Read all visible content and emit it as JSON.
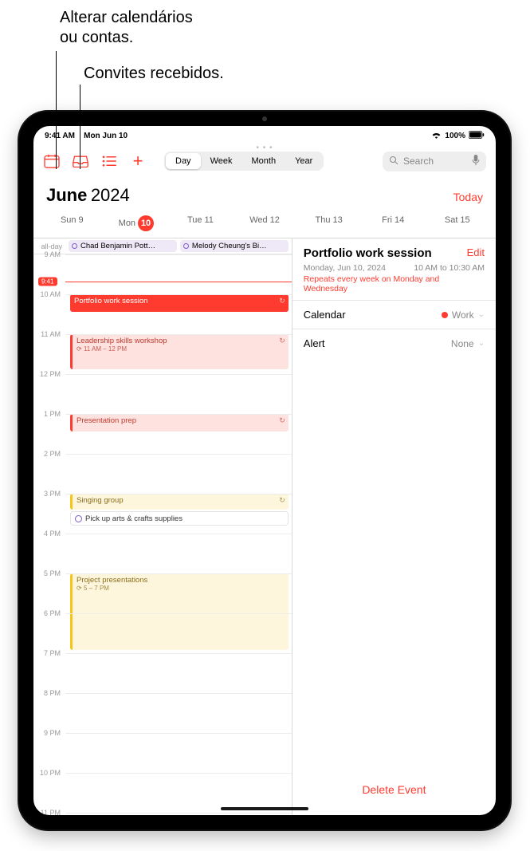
{
  "callouts": {
    "calendars": "Alterar calendários\nou contas.",
    "inbox": "Convites recebidos."
  },
  "status": {
    "time": "9:41 AM",
    "date": "Mon Jun 10",
    "battery": "100%"
  },
  "segments": {
    "day": "Day",
    "week": "Week",
    "month": "Month",
    "year": "Year"
  },
  "search": {
    "placeholder": "Search"
  },
  "header": {
    "month": "June",
    "year": "2024",
    "today": "Today"
  },
  "weekdays": [
    {
      "label": "Sun",
      "num": "9"
    },
    {
      "label": "Mon",
      "num": "10",
      "selected": true
    },
    {
      "label": "Tue",
      "num": "11"
    },
    {
      "label": "Wed",
      "num": "12"
    },
    {
      "label": "Thu",
      "num": "13"
    },
    {
      "label": "Fri",
      "num": "14"
    },
    {
      "label": "Sat",
      "num": "15"
    }
  ],
  "allday": {
    "label": "all-day",
    "items": [
      "Chad Benjamin Pott…",
      "Melody Cheung's Bi…"
    ]
  },
  "now": {
    "label": "9:41"
  },
  "hours": [
    "9 AM",
    "10 AM",
    "11 AM",
    "12 PM",
    "1 PM",
    "2 PM",
    "3 PM",
    "4 PM",
    "5 PM",
    "6 PM",
    "7 PM",
    "8 PM",
    "9 PM",
    "10 PM",
    "11 PM"
  ],
  "events": {
    "portfolio": {
      "title": "Portfolio work session"
    },
    "leadership": {
      "title": "Leadership skills workshop",
      "sub": "11 AM – 12 PM"
    },
    "presentation": {
      "title": "Presentation prep"
    },
    "singing": {
      "title": "Singing group"
    },
    "reminder": {
      "title": "Pick up arts & crafts supplies"
    },
    "project": {
      "title": "Project presentations",
      "sub": "5 – 7 PM"
    }
  },
  "details": {
    "title": "Portfolio work session",
    "edit": "Edit",
    "date": "Monday, Jun 10, 2024",
    "time": "10 AM to 10:30 AM",
    "repeat": "Repeats every week on Monday and Wednesday",
    "rows": {
      "calendar": {
        "label": "Calendar",
        "value": "Work"
      },
      "alert": {
        "label": "Alert",
        "value": "None"
      }
    },
    "delete": "Delete Event"
  }
}
